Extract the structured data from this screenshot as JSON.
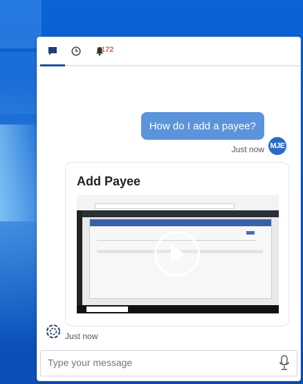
{
  "tabs": {
    "notifications_count": "172"
  },
  "messages": {
    "user": {
      "text": "How do I add a payee?",
      "time": "Just now",
      "avatar_initials": "MJE"
    },
    "bot": {
      "card_title": "Add Payee",
      "time": "Just now"
    }
  },
  "composer": {
    "placeholder": "Type your message"
  },
  "colors": {
    "accent": "#1b4f9c",
    "user_bubble": "#5b94db",
    "badge": "#e8614d"
  }
}
